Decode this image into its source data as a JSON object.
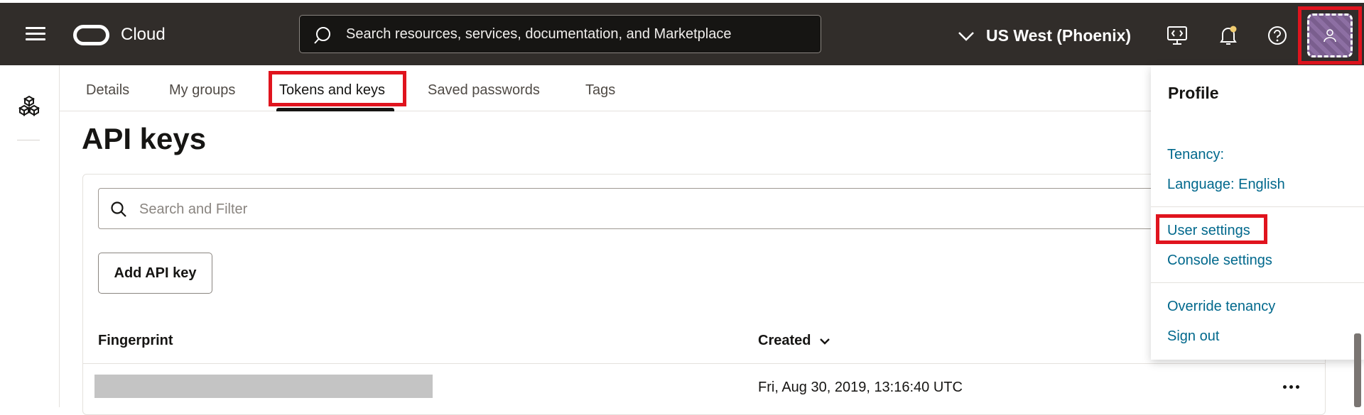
{
  "header": {
    "brand": "Cloud",
    "search_placeholder": "Search resources, services, documentation, and Marketplace",
    "region": "US West (Phoenix)"
  },
  "tabs": [
    {
      "label": "Details"
    },
    {
      "label": "My groups"
    },
    {
      "label": "Tokens and keys",
      "active": true
    },
    {
      "label": "Saved passwords"
    },
    {
      "label": "Tags"
    }
  ],
  "main": {
    "title": "API keys",
    "filter_placeholder": "Search and Filter",
    "add_button": "Add API key",
    "columns": {
      "fingerprint": "Fingerprint",
      "created": "Created"
    },
    "rows": [
      {
        "fingerprint": "",
        "created": "Fri, Aug 30, 2019, 13:16:40 UTC"
      }
    ]
  },
  "profile": {
    "title": "Profile",
    "tenancy": "Tenancy:",
    "language": "Language: English",
    "user_settings": "User settings",
    "console_settings": "Console settings",
    "override_tenancy": "Override tenancy",
    "sign_out": "Sign out"
  },
  "colors": {
    "topbar": "#312d2a",
    "link": "#00688c",
    "highlight": "#e0141e",
    "avatar": "#7a5e8e"
  },
  "icons": [
    "menu-icon",
    "oracle-logo-icon",
    "search-icon",
    "chevron-down-icon",
    "developer-tools-icon",
    "bell-icon",
    "help-icon",
    "user-icon",
    "cubes-icon",
    "kebab-icon"
  ]
}
